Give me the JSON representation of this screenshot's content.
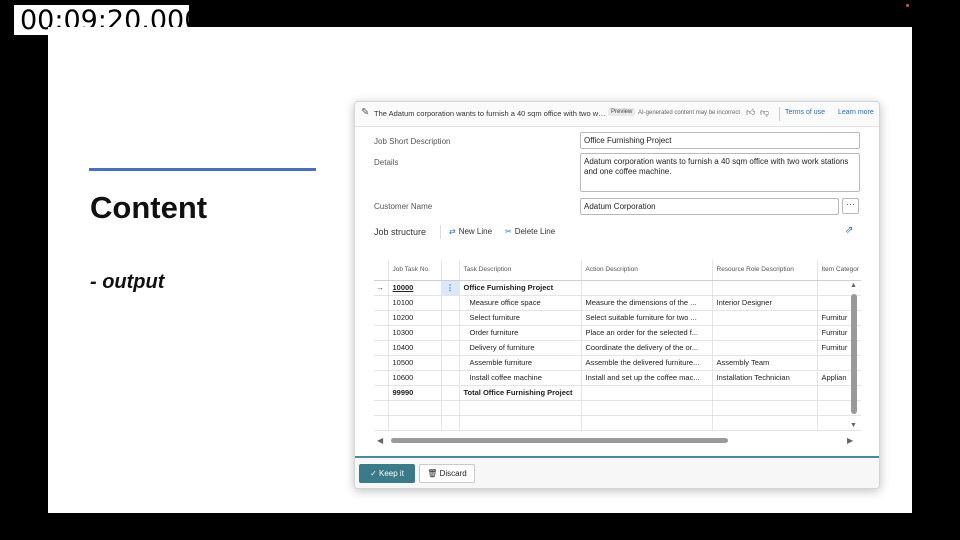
{
  "overlay": {
    "timecode": "00:09:20.000"
  },
  "slide": {
    "title": "Content",
    "subtitle": "- output"
  },
  "header": {
    "prompt": "The Adatum corporation wants to furnish a 40 sqm office with two wor...",
    "preview_badge": "Preview",
    "ai_note": "AI-generated content may be incorrect",
    "terms_link": "Terms of use",
    "learn_link": "Learn more"
  },
  "fields": {
    "job_short_description": {
      "label": "Job Short Description",
      "value": "Office Furnishing Project"
    },
    "details": {
      "label": "Details",
      "value": "Adatum corporation wants to furnish a 40 sqm office with two work stations and one coffee machine."
    },
    "customer_name": {
      "label": "Customer Name",
      "value": "Adatum Corporation"
    },
    "lookup_button": "···"
  },
  "toolbar": {
    "title": "Job structure",
    "new_line": "New Line",
    "delete_line": "Delete Line"
  },
  "grid": {
    "columns": [
      "Job Task No.",
      "Task Description",
      "Action Description",
      "Resource Role Description",
      "Item Categor"
    ],
    "row_marker": "→",
    "row_menu": "⋮",
    "rows": [
      {
        "no": "10000",
        "task": "Office Furnishing Project",
        "action": "",
        "role": "",
        "item": ""
      },
      {
        "no": "10100",
        "task": "Measure office space",
        "action": "Measure the dimensions of the ...",
        "role": "Interior Designer",
        "item": ""
      },
      {
        "no": "10200",
        "task": "Select furniture",
        "action": "Select suitable furniture for two ...",
        "role": "",
        "item": "Furnitur"
      },
      {
        "no": "10300",
        "task": "Order furniture",
        "action": "Place an order for the selected f...",
        "role": "",
        "item": "Furnitur"
      },
      {
        "no": "10400",
        "task": "Delivery of furniture",
        "action": "Coordinate the delivery of the or...",
        "role": "",
        "item": "Furnitur"
      },
      {
        "no": "10500",
        "task": "Assemble furniture",
        "action": "Assemble the delivered furniture...",
        "role": "Assembly Team",
        "item": ""
      },
      {
        "no": "10600",
        "task": "Install coffee machine",
        "action": "Install and set up the coffee mac...",
        "role": "Installation Technician",
        "item": "Applian"
      },
      {
        "no": "99990",
        "task": "Total Office Furnishing Project",
        "action": "",
        "role": "",
        "item": ""
      }
    ]
  },
  "footer": {
    "keep": "Keep it",
    "discard": "Discard"
  },
  "colors": {
    "accent": "#3b7a88",
    "link": "#2a6db5",
    "slide_rule": "#4a6fbf"
  }
}
